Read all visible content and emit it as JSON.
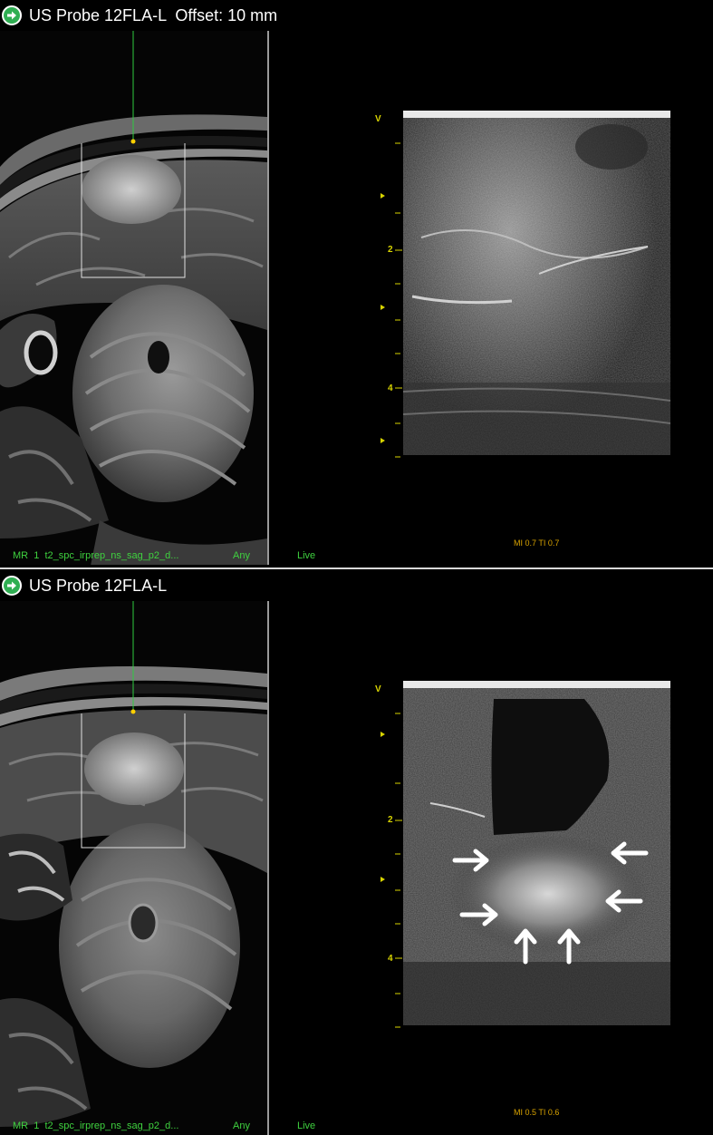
{
  "panels": [
    {
      "title": "US Probe 12FLA-L  Offset: 10 mm",
      "mr_label": "MR  1  t2_spc_irprep_ns_sag_p2_d...",
      "any_label": "Any",
      "live_label": "Live",
      "mi_label": "MI 0.7 TI 0.7",
      "depth_v": "V",
      "depth_2": "2",
      "depth_4": "4"
    },
    {
      "title": "US Probe 12FLA-L",
      "mr_label": "MR  1  t2_spc_irprep_ns_sag_p2_d...",
      "any_label": "Any",
      "live_label": "Live",
      "mi_label": "MI 0.5 TI 0.6",
      "depth_v": "V",
      "depth_2": "2",
      "depth_4": "4"
    }
  ],
  "colors": {
    "probe_line": "#2ecc40",
    "probe_dot": "#ffd000",
    "label_green": "#3fd23f",
    "ruler_yellow": "#d8d400",
    "mi_orange": "#d9a300",
    "icon_green": "#2fae52"
  },
  "icons": {
    "title": "right-arrow-circle-icon",
    "annotation": "white-arrow-icon"
  }
}
